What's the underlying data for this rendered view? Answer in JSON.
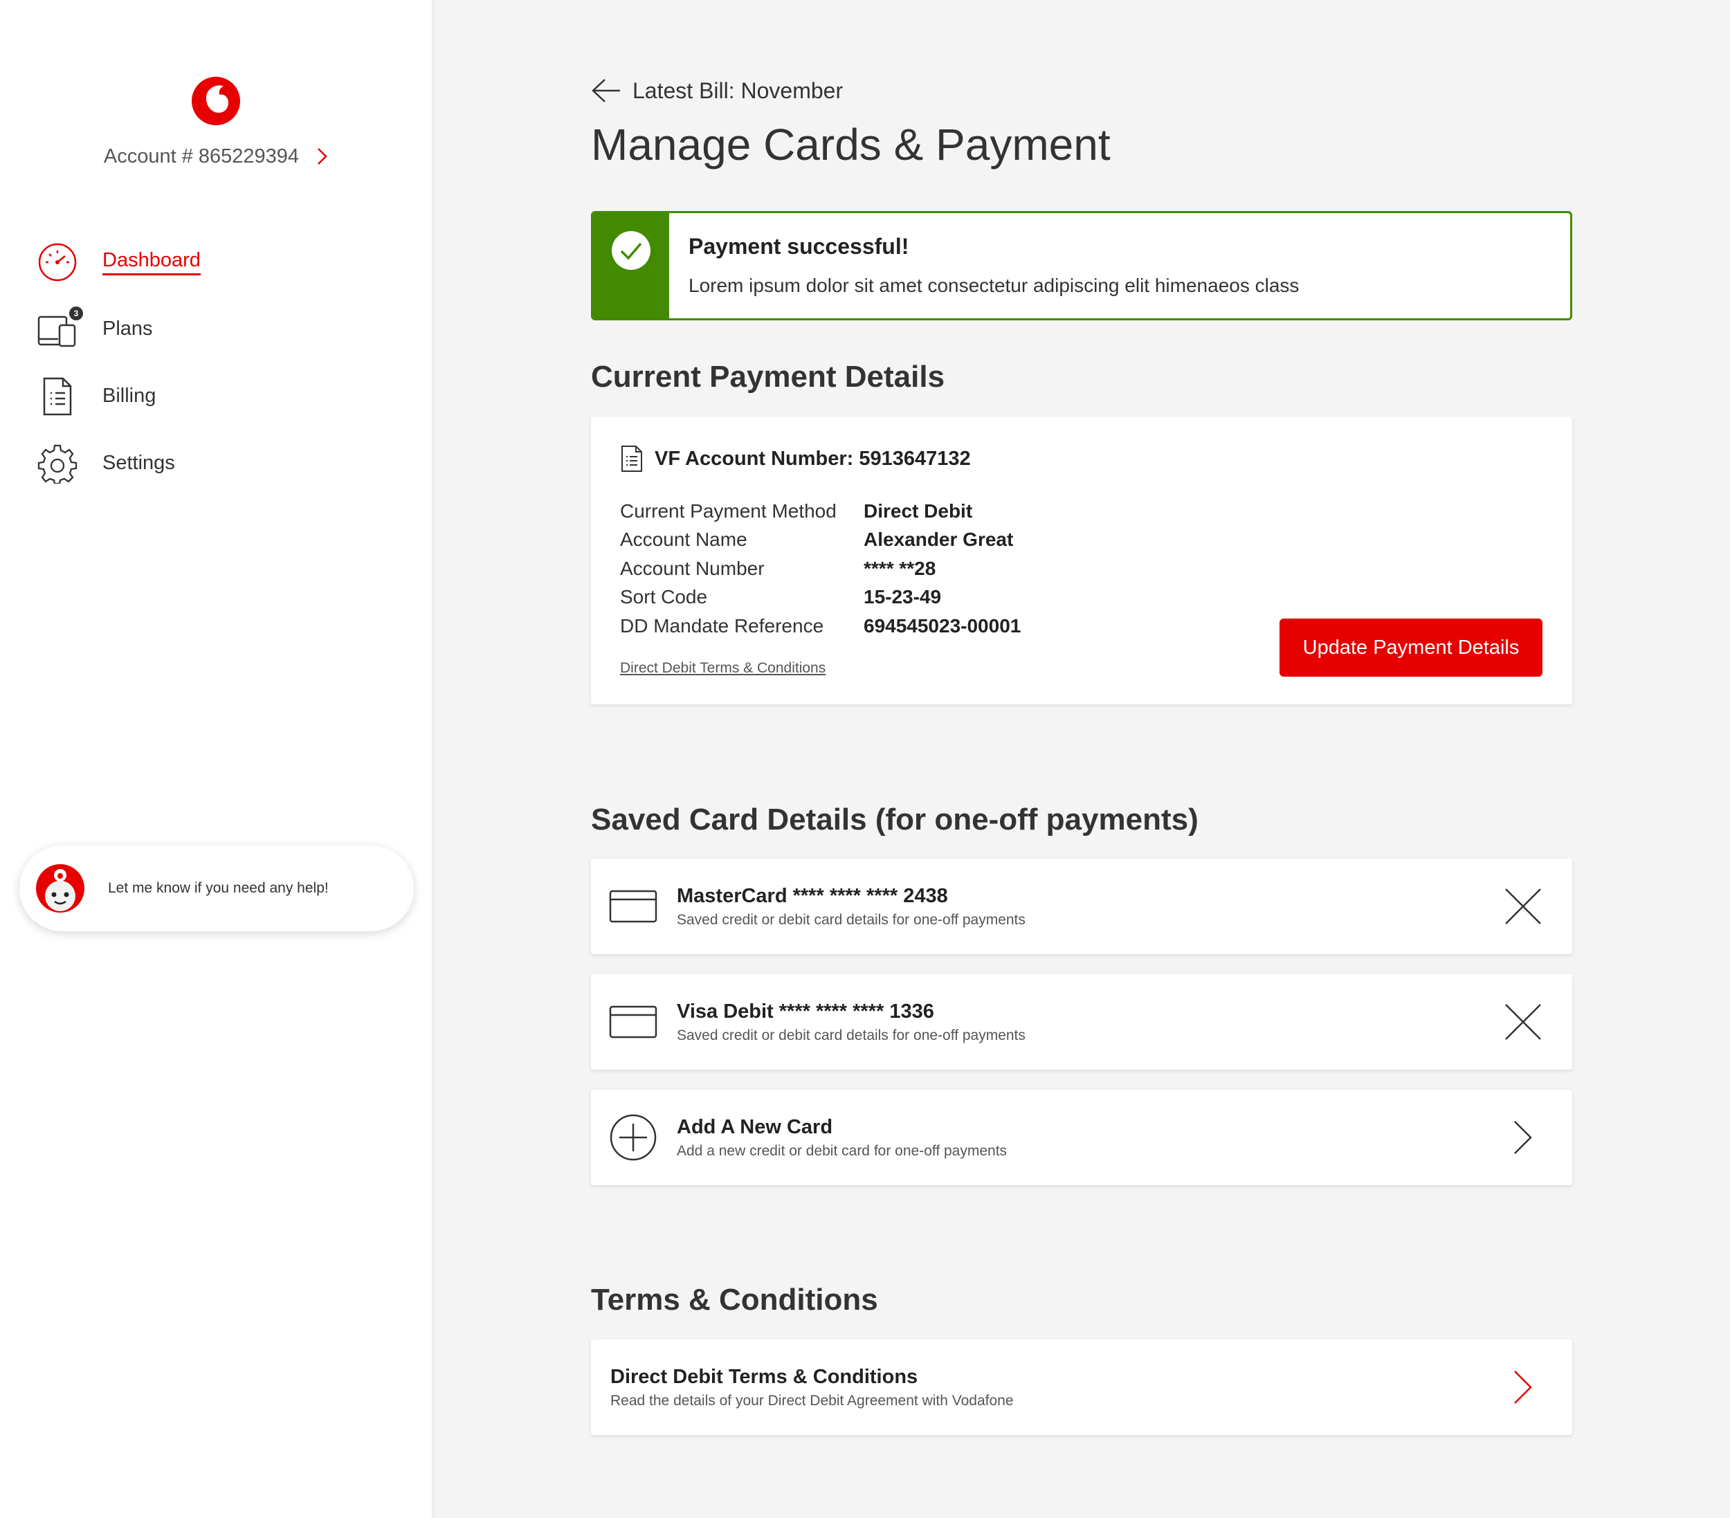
{
  "sidebar": {
    "account_label": "Account # 865229394",
    "nav": [
      {
        "label": "Dashboard",
        "icon": "dashboard-icon",
        "active": true
      },
      {
        "label": "Plans",
        "icon": "devices-icon",
        "badge": "3"
      },
      {
        "label": "Billing",
        "icon": "bill-icon"
      },
      {
        "label": "Settings",
        "icon": "gear-icon"
      }
    ],
    "help_text": "Let me know if you need any help!"
  },
  "header": {
    "back_label": "Latest Bill: November",
    "title": "Manage Cards & Payment"
  },
  "alert": {
    "title": "Payment successful!",
    "message": "Lorem ipsum dolor sit amet consectetur adipiscing elit himenaeos class"
  },
  "payment": {
    "section_title": "Current Payment Details",
    "account_title": "VF Account Number: 5913647132",
    "rows": [
      {
        "label": "Current Payment Method",
        "value": "Direct Debit"
      },
      {
        "label": "Account Name",
        "value": "Alexander Great"
      },
      {
        "label": "Account Number",
        "value": "**** **28"
      },
      {
        "label": "Sort Code",
        "value": "15-23-49"
      },
      {
        "label": "DD Mandate Reference",
        "value": "694545023-00001"
      }
    ],
    "terms_link": "Direct Debit Terms & Conditions",
    "update_button": "Update Payment Details"
  },
  "saved_cards": {
    "section_title": "Saved Card Details (for one-off payments)",
    "cards": [
      {
        "title": "MasterCard **** **** **** 2438",
        "subtitle": "Saved credit or debit card details for one-off payments"
      },
      {
        "title": "Visa Debit **** **** **** 1336",
        "subtitle": "Saved credit or debit card details for one-off payments"
      }
    ],
    "add_card": {
      "title": "Add A New Card",
      "subtitle": "Add a new credit or debit card for one-off payments"
    }
  },
  "terms": {
    "section_title": "Terms & Conditions",
    "item": {
      "title": "Direct Debit Terms & Conditions",
      "subtitle": "Read the details of your Direct Debit Agreement with Vodafone"
    }
  },
  "colors": {
    "brand_red": "#e60000",
    "success_green": "#428b00",
    "background": "#f4f4f4"
  }
}
